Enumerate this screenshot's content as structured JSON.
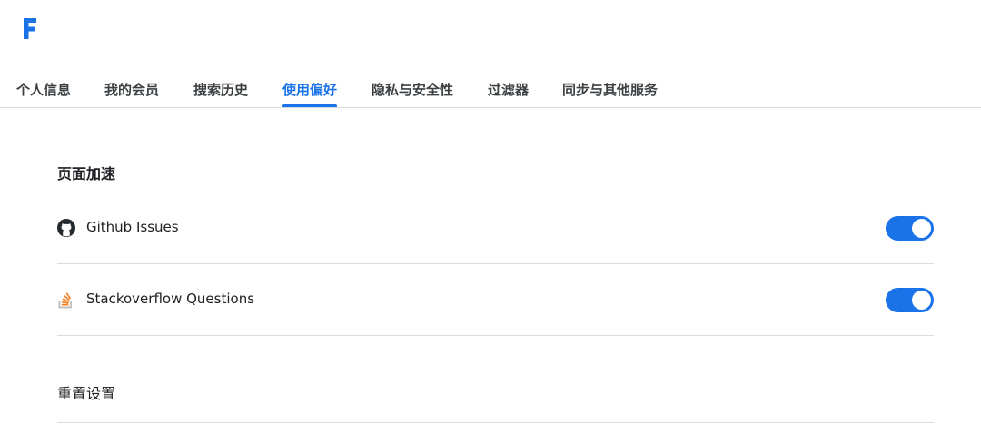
{
  "brand": {
    "logo_icon": "letter-f-logo-icon",
    "accent_color": "#1a73e8"
  },
  "tabs": [
    {
      "label": "个人信息",
      "active": false
    },
    {
      "label": "我的会员",
      "active": false
    },
    {
      "label": "搜索历史",
      "active": false
    },
    {
      "label": "使用偏好",
      "active": true
    },
    {
      "label": "隐私与安全性",
      "active": false
    },
    {
      "label": "过滤器",
      "active": false
    },
    {
      "label": "同步与其他服务",
      "active": false
    }
  ],
  "section": {
    "title": "页面加速",
    "items": [
      {
        "label": "Github Issues",
        "icon": "github-icon",
        "enabled": true
      },
      {
        "label": "Stackoverflow Questions",
        "icon": "stackoverflow-icon",
        "enabled": true
      }
    ]
  },
  "reset": {
    "label": "重置设置"
  }
}
